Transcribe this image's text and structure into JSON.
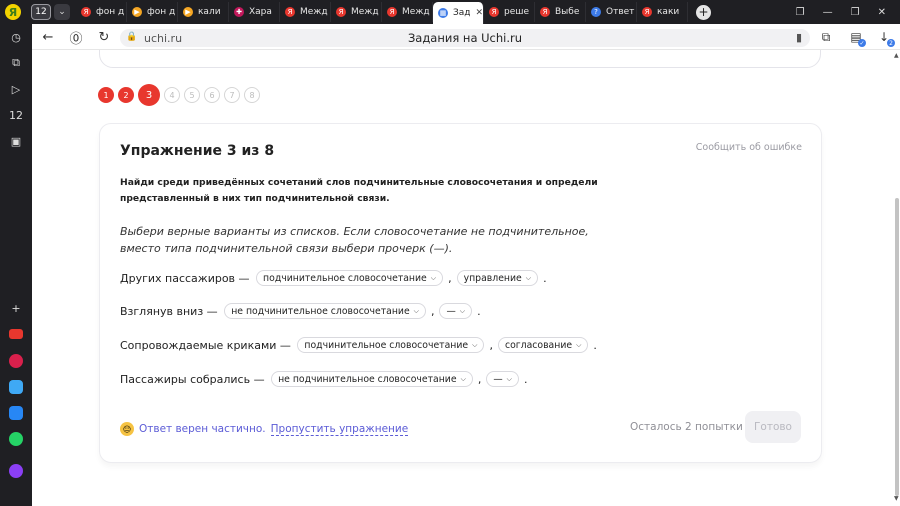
{
  "browser": {
    "tab_count": "12",
    "tabs": [
      {
        "label": "фон д",
        "fav_color": "#e8372e",
        "fav_glyph": "Я"
      },
      {
        "label": "фон д",
        "fav_color": "#f5a623",
        "fav_glyph": "▶"
      },
      {
        "label": "кали",
        "fav_color": "#f5a623",
        "fav_glyph": "▶"
      },
      {
        "label": "Хара",
        "fav_color": "#c2185b",
        "fav_glyph": "✚"
      },
      {
        "label": "Межд",
        "fav_color": "#e8372e",
        "fav_glyph": "Я"
      },
      {
        "label": "Межд",
        "fav_color": "#e8372e",
        "fav_glyph": "Я"
      },
      {
        "label": "Межд",
        "fav_color": "#e8372e",
        "fav_glyph": "Я"
      },
      {
        "label": "Зад",
        "fav_color": "#3d7be8",
        "fav_glyph": "▦",
        "active": true
      },
      {
        "label": "реше",
        "fav_color": "#e8372e",
        "fav_glyph": "Я"
      },
      {
        "label": "Выбе",
        "fav_color": "#e8372e",
        "fav_glyph": "Я"
      },
      {
        "label": "Ответ",
        "fav_color": "#3d7be8",
        "fav_glyph": "?"
      },
      {
        "label": "каки",
        "fav_color": "#e8372e",
        "fav_glyph": "Я"
      }
    ],
    "url": "uchi.ru",
    "page_title": "Задания на Uchi.ru",
    "ext_badge": "2"
  },
  "steps": [
    "1",
    "2",
    "3",
    "4",
    "5",
    "6",
    "7",
    "8"
  ],
  "current_step": 3,
  "exercise": {
    "title": "Упражнение 3 из 8",
    "report_link": "Сообщить об ошибке",
    "task": "Найди среди приведённых сочетаний слов подчинительные словосочетания и определи представленный в них тип подчинительной связи.",
    "hint": "Выбери верные варианты из списков. Если словосочетание не подчинительное, вместо типа подчинительной связи выбери прочерк (—).",
    "rows": [
      {
        "phrase": "Других пассажиров —",
        "kind": "подчинительное словосочетание",
        "type": "управление"
      },
      {
        "phrase": "Взглянув вниз —",
        "kind": "не подчинительное словосочетание",
        "type": "—"
      },
      {
        "phrase": "Сопровождаемые криками —",
        "kind": "подчинительное словосочетание",
        "type": "согласование"
      },
      {
        "phrase": "Пассажиры собрались —",
        "kind": "не подчинительное словосочетание",
        "type": "—"
      }
    ],
    "comma": ",",
    "period": ".",
    "feedback_text": "Ответ верен частично.",
    "skip_label": "Пропустить упражнение",
    "attempts_text": "Осталось 2 попытки",
    "done_label": "Готово"
  }
}
